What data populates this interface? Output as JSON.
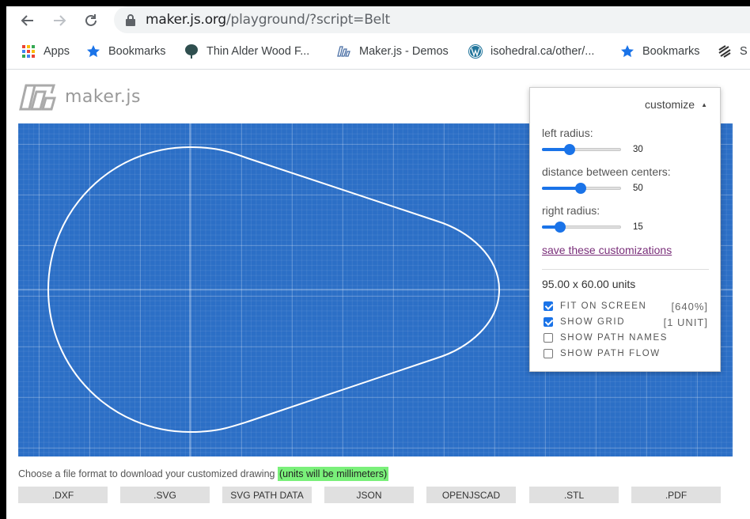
{
  "browser": {
    "url_host": "maker.js.org",
    "url_path": "/playground/?script=Belt",
    "bookmarks": [
      {
        "label": "Apps",
        "icon": "apps-grid-icon"
      },
      {
        "label": "Bookmarks",
        "icon": "star-icon"
      },
      {
        "label": "Thin Alder Wood F...",
        "icon": "tree-icon"
      },
      {
        "label": "Maker.js - Demos",
        "icon": "makerjs-icon"
      },
      {
        "label": "isohedral.ca/other/...",
        "icon": "wordpress-icon"
      },
      {
        "label": "Bookmarks",
        "icon": "star-icon"
      },
      {
        "label": "S",
        "icon": "stripes-icon"
      }
    ]
  },
  "logo": {
    "text": "maker.js"
  },
  "panel": {
    "toggle_label": "customize",
    "params": [
      {
        "label": "left radius:",
        "value": "30",
        "fraction": 0.32
      },
      {
        "label": "distance between centers:",
        "value": "50",
        "fraction": 0.49
      },
      {
        "label": "right radius:",
        "value": "15",
        "fraction": 0.19
      }
    ],
    "save_label": "save these customizations",
    "dimensions": "95.00 x 60.00 units",
    "options": [
      {
        "label": "FIT ON SCREEN",
        "value": "[640%]",
        "checked": true
      },
      {
        "label": "SHOW GRID",
        "value": "[1 UNIT]",
        "checked": true
      },
      {
        "label": "SHOW PATH NAMES",
        "value": "",
        "checked": false
      },
      {
        "label": "SHOW PATH FLOW",
        "value": "",
        "checked": false
      }
    ]
  },
  "download": {
    "prompt": "Choose a file format to download your customized drawing",
    "note": "(units will be millimeters)",
    "formats": [
      ".DXF",
      ".SVG",
      "SVG PATH DATA",
      "JSON",
      "OPENJSCAD",
      ".STL",
      ".PDF"
    ]
  },
  "colors": {
    "canvas": "#2c6fc6",
    "accent": "#1a73e8",
    "highlight": "#7af07a"
  }
}
